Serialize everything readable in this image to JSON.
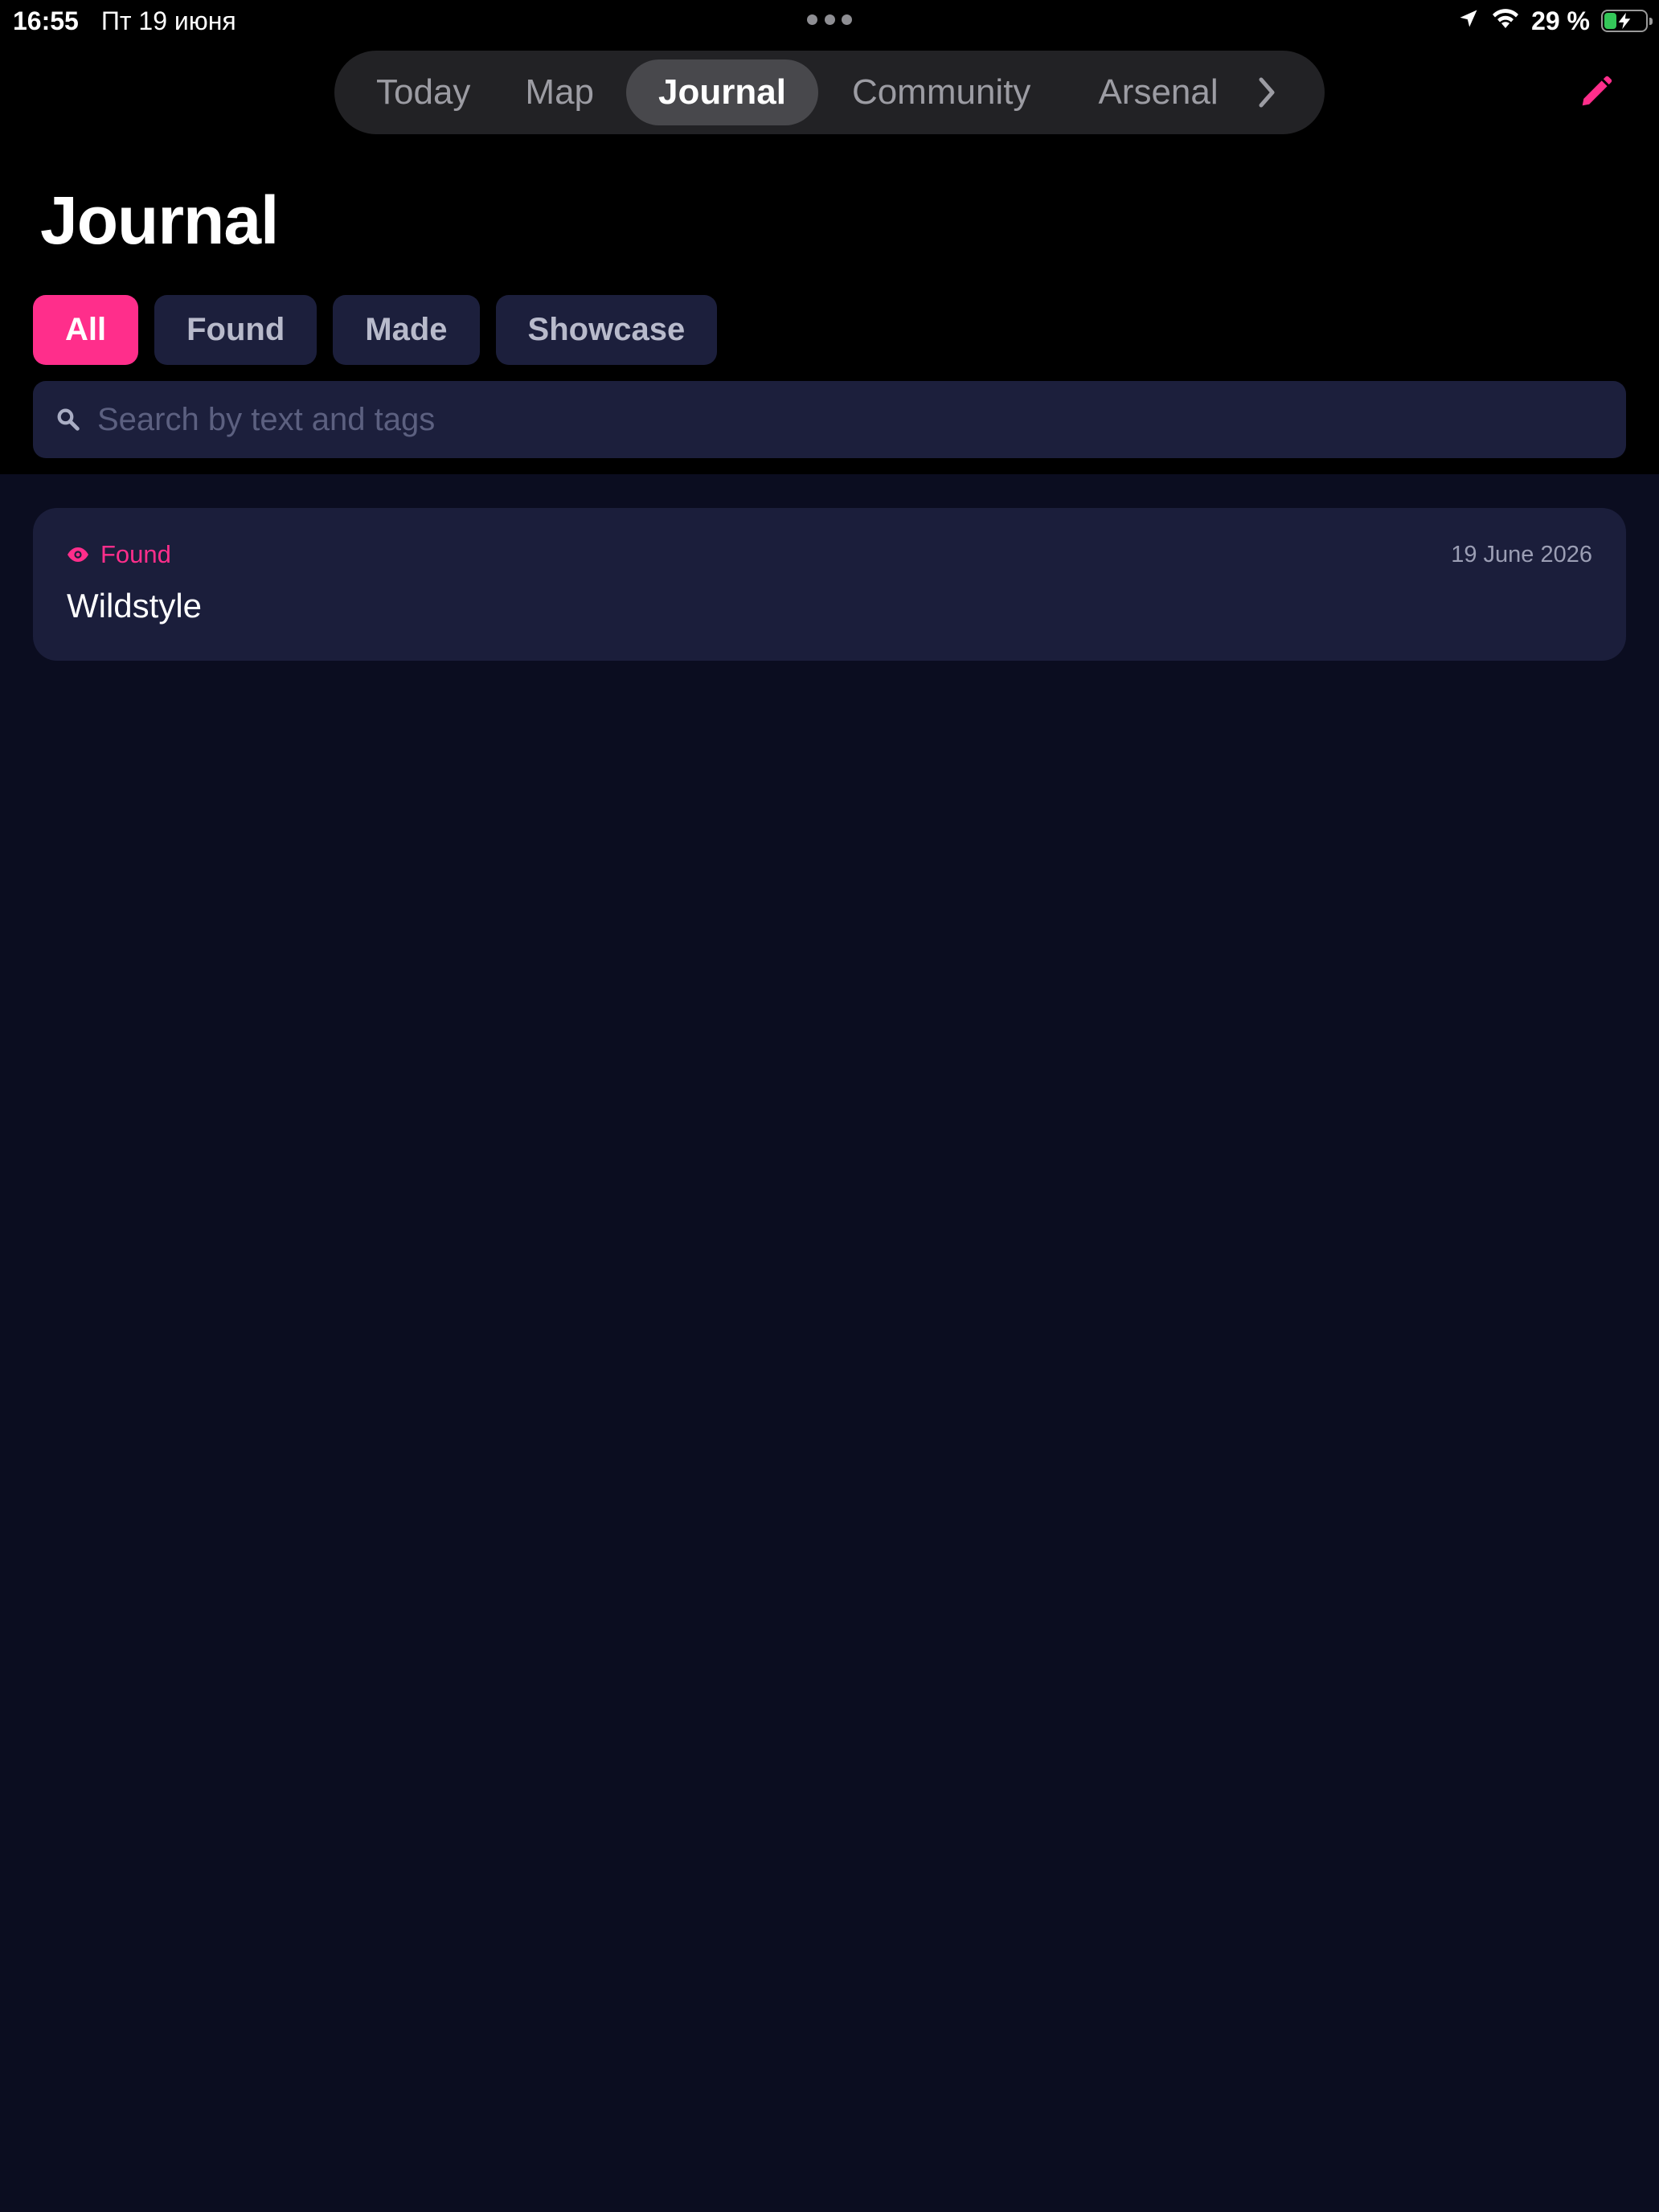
{
  "status_bar": {
    "time": "16:55",
    "date": "Пт 19 июня",
    "battery_percent": "29 %",
    "battery_level": 0.29,
    "icons": [
      "location-arrow-icon",
      "wifi-icon",
      "battery-charging-icon"
    ]
  },
  "nav": {
    "tabs": [
      {
        "label": "Today",
        "active": false
      },
      {
        "label": "Map",
        "active": false
      },
      {
        "label": "Journal",
        "active": true
      },
      {
        "label": "Community",
        "active": false
      },
      {
        "label": "Arsenal",
        "active": false
      }
    ],
    "more_icon": "chevron-right-icon",
    "edit_icon": "pencil-icon"
  },
  "page": {
    "title": "Journal"
  },
  "filters": [
    {
      "label": "All",
      "active": true
    },
    {
      "label": "Found",
      "active": false
    },
    {
      "label": "Made",
      "active": false
    },
    {
      "label": "Showcase",
      "active": false
    }
  ],
  "search": {
    "placeholder": "Search by text and tags",
    "value": "",
    "icon": "search-icon"
  },
  "entries": [
    {
      "kind": "Found",
      "kind_icon": "eye-icon",
      "date": "19 June 2026",
      "title": "Wildstyle"
    }
  ],
  "colors": {
    "accent": "#ff2e8b",
    "background": "#0b0d20",
    "header_background": "#000000",
    "surface": "#1c1f3c"
  }
}
